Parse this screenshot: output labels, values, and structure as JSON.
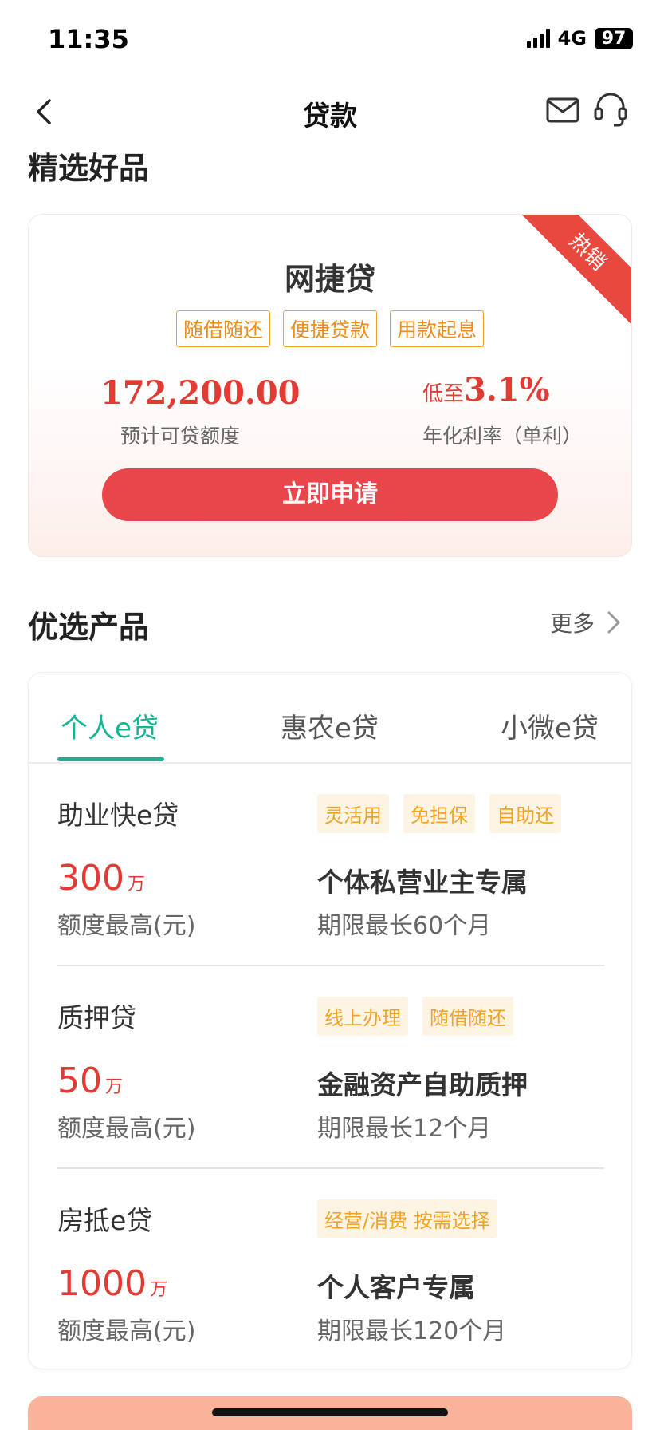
{
  "status": {
    "time": "11:35",
    "network": "4G",
    "battery": "97"
  },
  "nav": {
    "title": "贷款"
  },
  "featured": {
    "section_title": "精选好品",
    "ribbon": "热销",
    "name": "网捷贷",
    "tags": [
      "随借随还",
      "便捷贷款",
      "用款起息"
    ],
    "amount": "172,200.00",
    "amount_label": "预计可贷额度",
    "rate_prefix": "低至",
    "rate": "3.1%",
    "rate_label": "年化利率（单利）",
    "apply_label": "立即申请"
  },
  "products": {
    "section_title": "优选产品",
    "more_label": "更多",
    "tabs": [
      "个人e贷",
      "惠农e贷",
      "小微e贷"
    ],
    "active_tab": 0,
    "items": [
      {
        "name": "助业快e贷",
        "tags": [
          "灵活用",
          "免担保",
          "自助还"
        ],
        "limit": "300",
        "unit": "万",
        "limit_label": "额度最高(元)",
        "feature": "个体私营业主专属",
        "term": "期限最长60个月"
      },
      {
        "name": "质押贷",
        "tags": [
          "线上办理",
          "随借随还"
        ],
        "limit": "50",
        "unit": "万",
        "limit_label": "额度最高(元)",
        "feature": "金融资产自助质押",
        "term": "期限最长12个月"
      },
      {
        "name": "房抵e贷",
        "tags": [
          "经营/消费 按需选择"
        ],
        "limit": "1000",
        "unit": "万",
        "limit_label": "额度最高(元)",
        "feature": "个人客户专属",
        "term": "期限最长120个月"
      }
    ]
  },
  "colors": {
    "accent_red": "#e23b33",
    "tab_green": "#17b494",
    "tag_orange": "#f2a326"
  }
}
